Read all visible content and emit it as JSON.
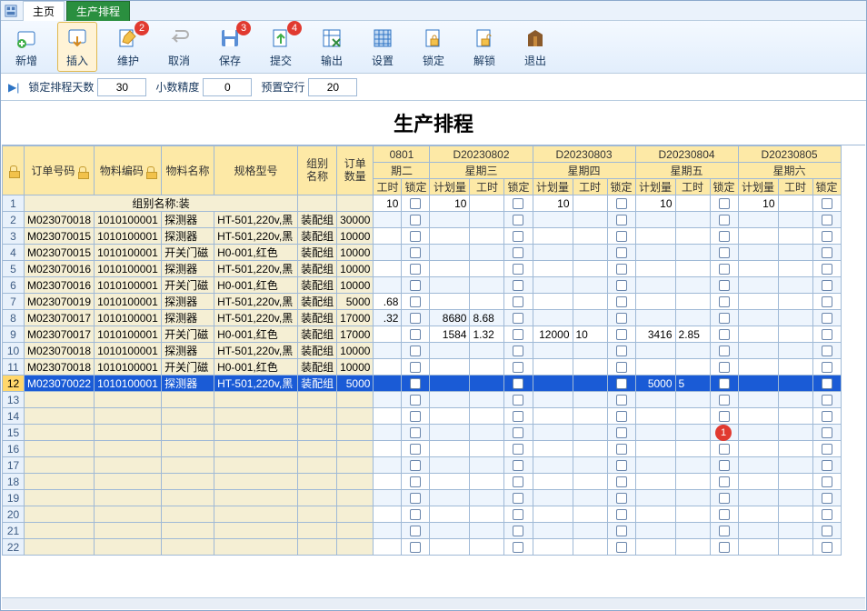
{
  "tabs": {
    "home": "主页",
    "prod": "生产排程"
  },
  "toolbar": {
    "add": "新增",
    "insert": "插入",
    "maintain": "维护",
    "cancel": "取消",
    "save": "保存",
    "submit": "提交",
    "export": "输出",
    "settings": "设置",
    "lock": "锁定",
    "unlock": "解锁",
    "exit": "退出",
    "badge_maintain": "2",
    "badge_save": "3",
    "badge_submit": "4"
  },
  "params": {
    "lockdays_label": "锁定排程天数",
    "lockdays": "30",
    "decimal_label": "小数精度",
    "decimal": "0",
    "blank_label": "预置空行",
    "blank": "20"
  },
  "title": "生产排程",
  "cols": {
    "order": "订单号码",
    "matcode": "物料编码",
    "matname": "物料名称",
    "spec": "规格型号",
    "group": "组别\n名称",
    "qty": "订单\n数量",
    "plan": "计划量",
    "hours": "工时",
    "locked": "锁定",
    "d801": "0801",
    "d802": "D20230802",
    "d803": "D20230803",
    "d804": "D20230804",
    "d805": "D20230805",
    "w2": "期二",
    "w3": "星期三",
    "w4": "星期四",
    "w5": "星期五",
    "w6": "星期六"
  },
  "group_row": "组别名称:装",
  "summary": {
    "d801_h": "10",
    "d802_p": "10",
    "d803_p": "10",
    "d804_p": "10",
    "d805_p": "10"
  },
  "rows": [
    {
      "n": "2",
      "o": "M023070018",
      "c": "1010100001",
      "m": "探测器",
      "s": "HT-501,220v,黑",
      "g": "装配组",
      "q": "30000"
    },
    {
      "n": "3",
      "o": "M023070015",
      "c": "1010100001",
      "m": "探测器",
      "s": "HT-501,220v,黑",
      "g": "装配组",
      "q": "10000"
    },
    {
      "n": "4",
      "o": "M023070015",
      "c": "1010100001",
      "m": "开关门磁",
      "s": "H0-001,红色",
      "g": "装配组",
      "q": "10000"
    },
    {
      "n": "5",
      "o": "M023070016",
      "c": "1010100001",
      "m": "探测器",
      "s": "HT-501,220v,黑",
      "g": "装配组",
      "q": "10000"
    },
    {
      "n": "6",
      "o": "M023070016",
      "c": "1010100001",
      "m": "开关门磁",
      "s": "H0-001,红色",
      "g": "装配组",
      "q": "10000"
    },
    {
      "n": "7",
      "o": "M023070019",
      "c": "1010100001",
      "m": "探测器",
      "s": "HT-501,220v,黑",
      "g": "装配组",
      "q": "5000",
      "d801_h": ".68"
    },
    {
      "n": "8",
      "o": "M023070017",
      "c": "1010100001",
      "m": "探测器",
      "s": "HT-501,220v,黑",
      "g": "装配组",
      "q": "17000",
      "d801_h": ".32",
      "d802_p": "8680",
      "d802_h": "8.68"
    },
    {
      "n": "9",
      "o": "M023070017",
      "c": "1010100001",
      "m": "开关门磁",
      "s": "H0-001,红色",
      "g": "装配组",
      "q": "17000",
      "d802_p": "1584",
      "d802_h": "1.32",
      "d803_p": "12000",
      "d803_h": "10",
      "d804_p": "3416",
      "d804_h": "2.85"
    },
    {
      "n": "10",
      "o": "M023070018",
      "c": "1010100001",
      "m": "探测器",
      "s": "HT-501,220v,黑",
      "g": "装配组",
      "q": "10000"
    },
    {
      "n": "11",
      "o": "M023070018",
      "c": "1010100001",
      "m": "开关门磁",
      "s": "H0-001,红色",
      "g": "装配组",
      "q": "10000"
    },
    {
      "n": "12",
      "o": "M023070022",
      "c": "1010100001",
      "m": "探测器",
      "s": "HT-501,220v,黑",
      "g": "装配组",
      "q": "5000",
      "d804_p": "5000",
      "d804_h": "5",
      "sel": true
    }
  ],
  "callout": "1"
}
